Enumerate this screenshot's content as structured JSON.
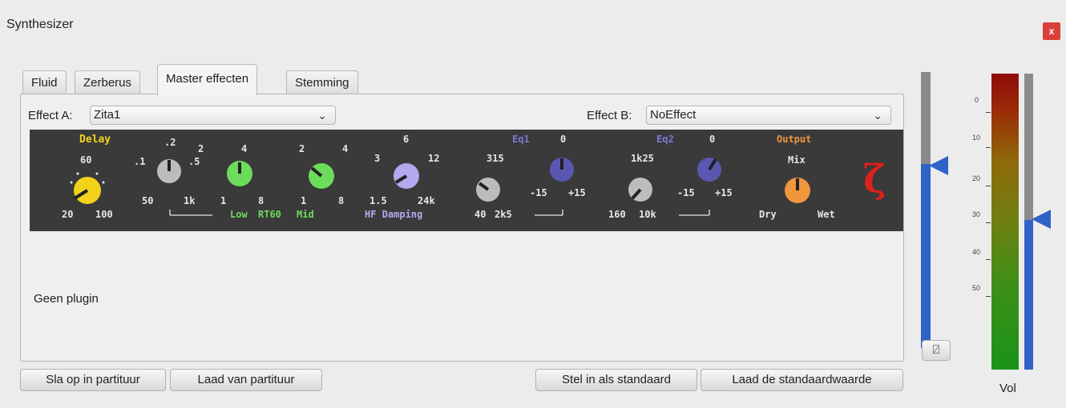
{
  "window": {
    "title": "Synthesizer",
    "close_label": "x"
  },
  "tabs": [
    {
      "label": "Fluid"
    },
    {
      "label": "Zerberus"
    },
    {
      "label": "Master effecten",
      "active": true
    },
    {
      "label": "Stemming"
    }
  ],
  "effect_a": {
    "label": "Effect A:",
    "value": "Zita1"
  },
  "effect_b": {
    "label": "Effect B:",
    "value": "NoEffect"
  },
  "zita": {
    "delay": {
      "title": "Delay",
      "top": "60",
      "left": "20",
      "right": "100"
    },
    "rt_low": {
      "top": ".2",
      "left_top": ".1",
      "right_top": ".5",
      "left": "50",
      "right": "1k"
    },
    "low": {
      "left_top": "2",
      "right_top": "4",
      "left": "1",
      "right": "8"
    },
    "mid": {
      "left_top": "2",
      "right_top": "4",
      "left": "1",
      "right": "8"
    },
    "hf": {
      "top": "6",
      "left_top": "3",
      "right_top": "12",
      "left": "1.5",
      "right": "24k"
    },
    "rt60_labels": {
      "low": "Low",
      "rt60": "RT60",
      "mid": "Mid",
      "hf": "HF Damping"
    },
    "eq1": {
      "title": "Eq1",
      "freq_top": "315",
      "freq_left": "40",
      "freq_right": "2k5",
      "gain_top": "0",
      "gain_left": "-15",
      "gain_right": "+15"
    },
    "eq2": {
      "title": "Eq2",
      "freq_top": "1k25",
      "freq_left": "160",
      "freq_right": "10k",
      "gain_top": "0",
      "gain_left": "-15",
      "gain_right": "+15"
    },
    "output": {
      "title": "Output",
      "top": "Mix",
      "left": "Dry",
      "right": "Wet"
    },
    "logo": "ζ",
    "colors": {
      "yellow": "#f2d21a",
      "white": "#e6e6e6",
      "green": "#6ddc5c",
      "lavender": "#b3a9f0",
      "grey": "#bcbcbc",
      "blue": "#5a57b3",
      "orange": "#f0963c",
      "red": "#e0201c"
    }
  },
  "no_plugin": "Geen plugin",
  "buttons": {
    "save_score": "Sla op in partituur",
    "load_score": "Laad van partituur",
    "set_default": "Stel in als standaard",
    "load_default": "Laad de standaardwaarde"
  },
  "tune_button": {
    "icon": "tuning-fork-icon",
    "glyph": "⍁"
  },
  "meter": {
    "scale": [
      "0",
      "10",
      "20",
      "30",
      "40",
      "50"
    ],
    "label": "Vol",
    "volume_level": 0.5,
    "master_slider_level": 0.67
  }
}
